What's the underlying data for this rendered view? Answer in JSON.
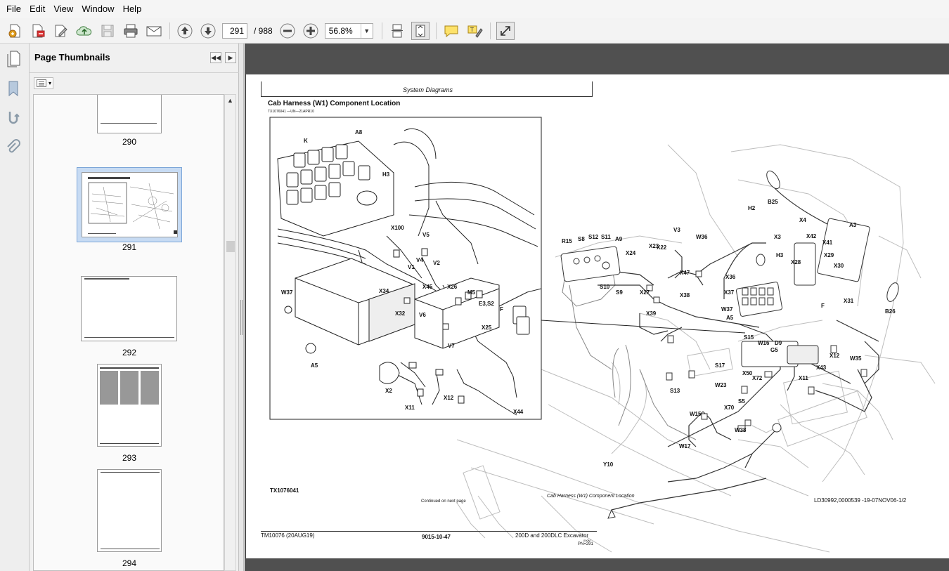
{
  "menu": {
    "items": [
      "File",
      "Edit",
      "View",
      "Window",
      "Help"
    ]
  },
  "toolbar": {
    "page_number": "291",
    "page_total": "/ 988",
    "zoom": "56.8%"
  },
  "panel": {
    "title": "Page Thumbnails",
    "thumbnails": [
      {
        "label": "290"
      },
      {
        "label": "291"
      },
      {
        "label": "292"
      },
      {
        "label": "293"
      },
      {
        "label": "294"
      }
    ]
  },
  "document": {
    "header_section": "System Diagrams",
    "title": "Cab Harness (W1) Component Location",
    "image_ref": "TX1076041 —UN—21APR10",
    "figure_id": "TX1076041",
    "continued": "Continued on next page",
    "figure_caption": "Cab Harness (W1) Component Location",
    "doc_ref": "LD30992,0000539 -19-07NOV06-1/2",
    "footer_left": "TM10076 (20AUG19)",
    "footer_center": "9015-10-47",
    "footer_right": "200D and 200DLC Excavator",
    "footer_right_small": "000M",
    "footer_pn": "PN=291",
    "labels_inset": [
      "A8",
      "K",
      "H3",
      "X100",
      "V5",
      "V4",
      "V2",
      "V1",
      "X45",
      "W37",
      "X34",
      "X26",
      "M5",
      "E3,S2",
      "F",
      "X32",
      "V6",
      "X25",
      "V7",
      "A5",
      "X2",
      "X12",
      "X11",
      "X44"
    ],
    "labels_main": [
      "B25",
      "H2",
      "X4",
      "A3",
      "X3",
      "X42",
      "X41",
      "V3",
      "W36",
      "R15",
      "S8",
      "S12",
      "S11",
      "A9",
      "X23",
      "X22",
      "X24",
      "X47",
      "X36",
      "X37",
      "X38",
      "S10",
      "S9",
      "X27",
      "X39",
      "H3",
      "X28",
      "X29",
      "X30",
      "X31",
      "B26",
      "W37",
      "A5",
      "F",
      "S15",
      "W16",
      "D9",
      "G5",
      "X12",
      "X43",
      "W35",
      "S17",
      "X50",
      "X72",
      "X11",
      "S13",
      "W23",
      "S5",
      "X70",
      "W15",
      "W38",
      "W17",
      "Y10"
    ]
  }
}
